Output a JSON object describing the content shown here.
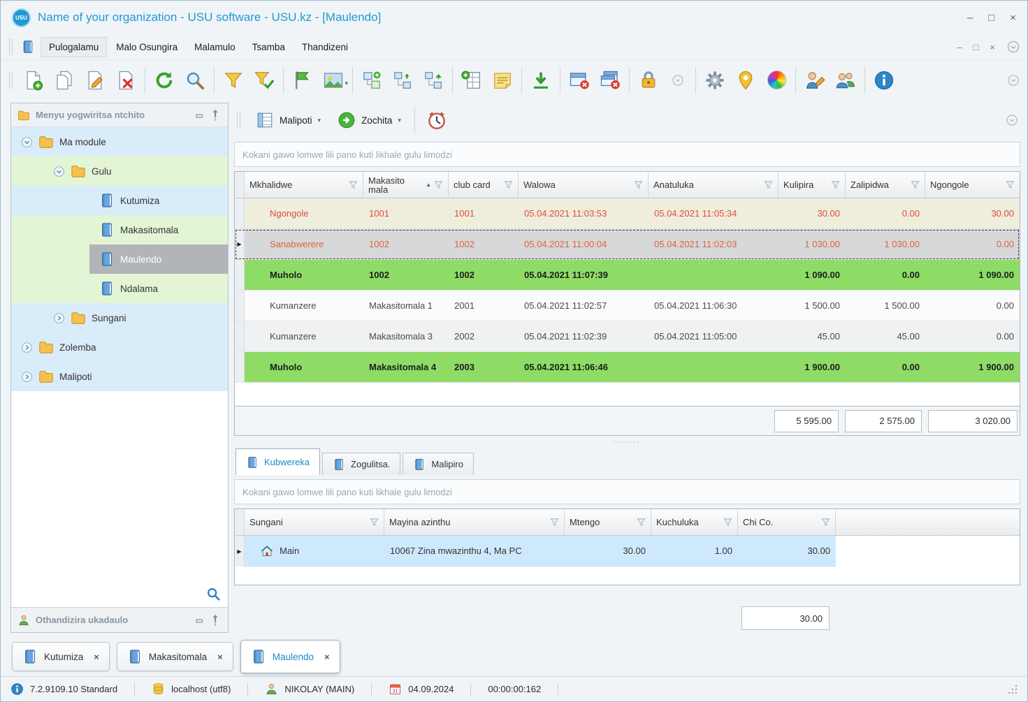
{
  "window": {
    "title": "Name of your organization - USU software - USU.kz - [Maulendo]",
    "logo_text": "USU"
  },
  "icons": {
    "minimize": "–",
    "maximize": "□",
    "close": "×",
    "float": "▭",
    "dropdown": "▾",
    "sort_asc": "▲",
    "row_marker": "▶",
    "splitter_dots": "·······"
  },
  "menubar": {
    "items": [
      "Pulogalamu",
      "Malo Osungira",
      "Malamulo",
      "Tsamba",
      "Thandizeni"
    ]
  },
  "sidebar": {
    "title": "Menyu yogwiritsa ntchito",
    "support_title": "Othandizira ukadaulo",
    "tree": [
      "Ma module",
      "Gulu",
      "Kutumiza",
      "Makasitomala",
      "Maulendo",
      "Ndalama",
      "Sungani",
      "Zolemba",
      "Malipoti"
    ]
  },
  "main": {
    "reports_button": "Malipoti",
    "actions_button": "Zochita",
    "group_hint": "Kokani gawo lomwe lili pano kuti likhale gulu limodzi",
    "grid": {
      "columns": [
        "Mkhalidwe",
        "Makasito mala",
        "club card",
        "Walowa",
        "Anatuluka",
        "Kulipira",
        "Zalipidwa",
        "Ngongole"
      ],
      "rows": [
        {
          "mkhalidwe": "Ngongole",
          "makasitomala": "1001",
          "club_card": "1001",
          "walowa": "05.04.2021 11:03:53",
          "anatuluka": "05.04.2021 11:05:34",
          "kulipira": "30.00",
          "zalipidwa": "0.00",
          "ngongole": "30.00"
        },
        {
          "mkhalidwe": "Sanabwerere",
          "makasitomala": "1002",
          "club_card": "1002",
          "walowa": "05.04.2021 11:00:04",
          "anatuluka": "05.04.2021 11:02:03",
          "kulipira": "1 030.00",
          "zalipidwa": "1 030.00",
          "ngongole": "0.00"
        },
        {
          "mkhalidwe": "Muholo",
          "makasitomala": "1002",
          "club_card": "1002",
          "walowa": "05.04.2021 11:07:39",
          "anatuluka": "",
          "kulipira": "1 090.00",
          "zalipidwa": "0.00",
          "ngongole": "1 090.00"
        },
        {
          "mkhalidwe": "Kumanzere",
          "makasitomala": "Makasitomala 1",
          "club_card": "2001",
          "walowa": "05.04.2021 11:02:57",
          "anatuluka": "05.04.2021 11:06:30",
          "kulipira": "1 500.00",
          "zalipidwa": "1 500.00",
          "ngongole": "0.00"
        },
        {
          "mkhalidwe": "Kumanzere",
          "makasitomala": "Makasitomala 3",
          "club_card": "2002",
          "walowa": "05.04.2021 11:02:39",
          "anatuluka": "05.04.2021 11:05:00",
          "kulipira": "45.00",
          "zalipidwa": "45.00",
          "ngongole": "0.00"
        },
        {
          "mkhalidwe": "Muholo",
          "makasitomala": "Makasitomala 4",
          "club_card": "2003",
          "walowa": "05.04.2021 11:06:46",
          "anatuluka": "",
          "kulipira": "1 900.00",
          "zalipidwa": "0.00",
          "ngongole": "1 900.00"
        }
      ],
      "summary": {
        "kulipira": "5 595.00",
        "zalipidwa": "2 575.00",
        "ngongole": "3 020.00"
      }
    },
    "detail": {
      "tabs": [
        "Kubwereka",
        "Zogulitsa.",
        "Malipiro"
      ],
      "group_hint": "Kokani gawo lomwe lili pano kuti likhale gulu limodzi",
      "columns": [
        "Sungani",
        "Mayina azinthu",
        "Mtengo",
        "Kuchuluka",
        "Chi Co."
      ],
      "row": {
        "sungani": "Main",
        "mayina": "10067 Zina mwazinthu 4, Ma PC",
        "mtengo": "30.00",
        "kuchuluka": "1.00",
        "chico": "30.00"
      },
      "summary": "30.00"
    }
  },
  "doc_tabs": [
    "Kutumiza",
    "Makasitomala",
    "Maulendo"
  ],
  "statusbar": {
    "version": "7.2.9109.10 Standard",
    "database": "localhost (utf8)",
    "user": "NIKOLAY (MAIN)",
    "calendar_day": "31",
    "date": "04.09.2024",
    "timer": "00:00:00:162"
  },
  "colors": {
    "accent_blue": "#1d9ad6",
    "paid_green": "#8edc66",
    "debt_row_bg": "#efeedd",
    "alert_red": "#e04a3a",
    "selected_row_bg": "#d6d8d9",
    "detail_row_blue": "#cfe9fc"
  }
}
